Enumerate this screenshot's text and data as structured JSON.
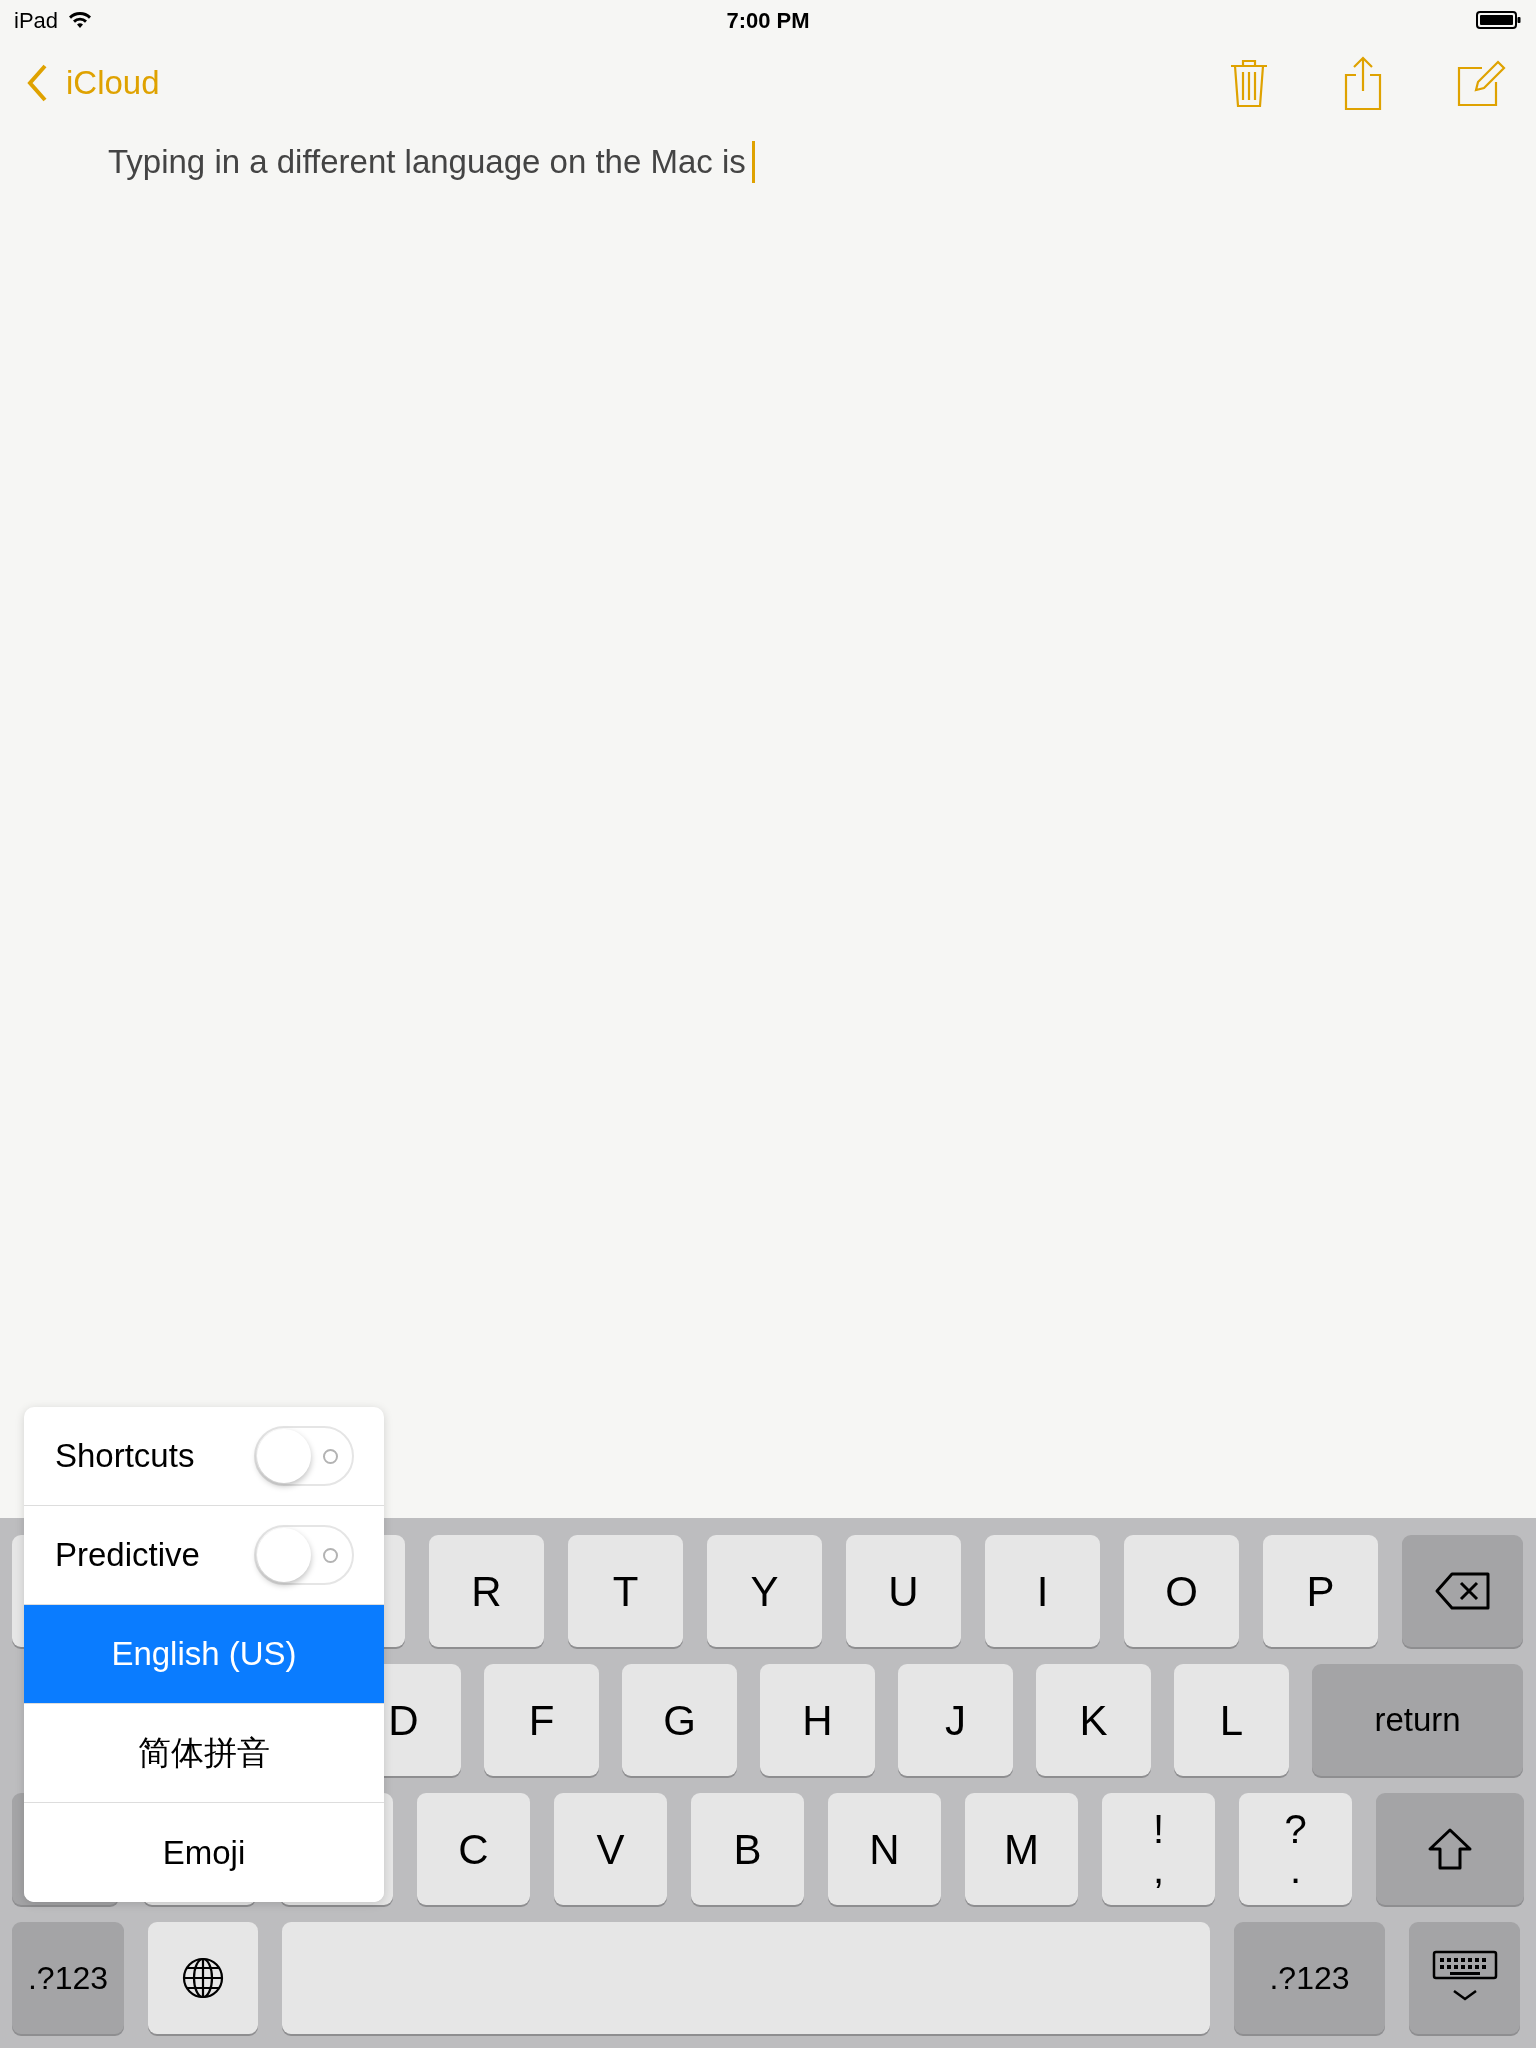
{
  "status_bar": {
    "device": "iPad",
    "time": "7:00 PM"
  },
  "nav": {
    "back_label": "iCloud"
  },
  "note": {
    "text": "Typing in a different language on the Mac is"
  },
  "keyboard": {
    "key_rows": [
      {
        "keys": [
          {
            "kind": "covered"
          },
          {
            "kind": "slot"
          },
          {
            "kind": "covered"
          },
          {
            "kind": "letter",
            "label": "R"
          },
          {
            "kind": "letter",
            "label": "T"
          },
          {
            "kind": "letter",
            "label": "Y"
          },
          {
            "kind": "letter",
            "label": "U"
          },
          {
            "kind": "letter",
            "label": "I"
          },
          {
            "kind": "letter",
            "label": "O"
          },
          {
            "kind": "letter",
            "label": "P"
          },
          {
            "kind": "delete"
          }
        ]
      },
      {
        "keys": [
          {
            "kind": "slot"
          },
          {
            "kind": "slot"
          },
          {
            "kind": "letter",
            "label": "D"
          },
          {
            "kind": "letter",
            "label": "F"
          },
          {
            "kind": "letter",
            "label": "G"
          },
          {
            "kind": "letter",
            "label": "H"
          },
          {
            "kind": "letter",
            "label": "J"
          },
          {
            "kind": "letter",
            "label": "K"
          },
          {
            "kind": "letter",
            "label": "L"
          },
          {
            "kind": "return",
            "label": "return"
          }
        ]
      },
      {
        "keys": [
          {
            "kind": "shift_left"
          },
          {
            "kind": "covered"
          },
          {
            "kind": "covered"
          },
          {
            "kind": "letter",
            "label": "C"
          },
          {
            "kind": "letter",
            "label": "V"
          },
          {
            "kind": "letter",
            "label": "B"
          },
          {
            "kind": "letter",
            "label": "N"
          },
          {
            "kind": "letter",
            "label": "M"
          },
          {
            "kind": "punct",
            "top": "!",
            "bottom": ","
          },
          {
            "kind": "punct",
            "top": "?",
            "bottom": "."
          },
          {
            "kind": "shift"
          }
        ]
      },
      {
        "keys": [
          {
            "kind": "numbers",
            "label": ".?123"
          },
          {
            "kind": "globe"
          },
          {
            "kind": "space"
          },
          {
            "kind": "numbers_wide",
            "label": ".?123"
          },
          {
            "kind": "hide"
          }
        ]
      }
    ]
  },
  "popup": {
    "toggles": [
      {
        "label": "Shortcuts",
        "on": false
      },
      {
        "label": "Predictive",
        "on": false
      }
    ],
    "languages": [
      {
        "label": "English (US)",
        "selected": true
      },
      {
        "label": "简体拼音",
        "selected": false
      },
      {
        "label": "Emoji",
        "selected": false
      }
    ]
  }
}
